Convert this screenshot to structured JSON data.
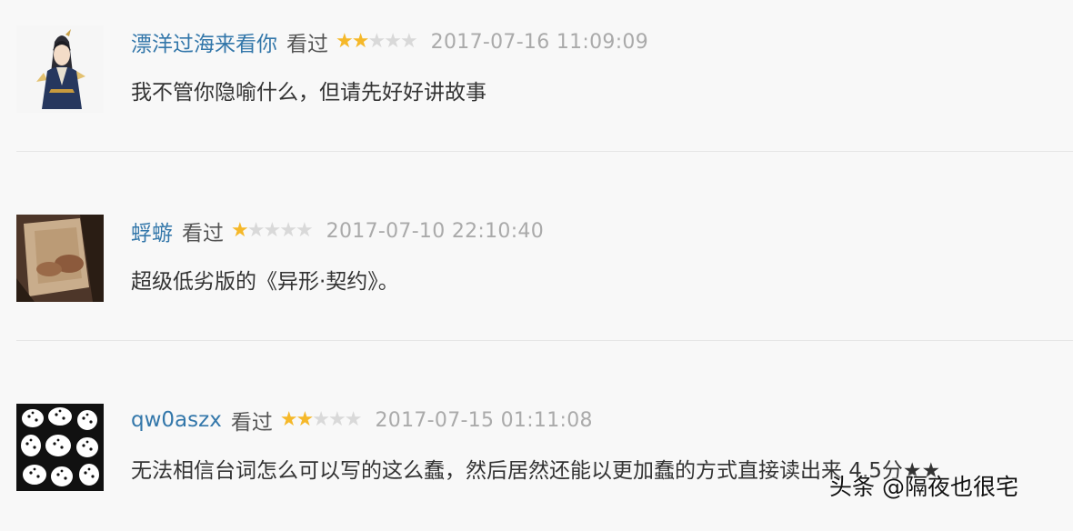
{
  "comments": [
    {
      "username": "漂洋过海来看你",
      "status": "看过",
      "rating": 2,
      "rating_max": 5,
      "date": "2017-07-16 11:09:09",
      "content": "我不管你隐喻什么，但请先好好讲故事",
      "avatar": "avatar-illustrated-girl"
    },
    {
      "username": "蜉蝣",
      "status": "看过",
      "rating": 1,
      "rating_max": 5,
      "date": "2017-07-10 22:10:40",
      "content": "超级低劣版的《异形·契约》。",
      "avatar": "avatar-photo-hands"
    },
    {
      "username": "qw0aszx",
      "status": "看过",
      "rating": 2,
      "rating_max": 5,
      "date": "2017-07-15 01:11:08",
      "content": "无法相信台词怎么可以写的这么蠢，然后居然还能以更加蠢的方式直接读出来 4.5分★★",
      "avatar": "avatar-bw-pattern"
    }
  ],
  "watermark": "头条 @隔夜也很宅",
  "colors": {
    "username": "#3377aa",
    "star_on": "#f5b829",
    "star_off": "#d9d9d9",
    "date": "#aaaaaa",
    "text": "#333333"
  }
}
